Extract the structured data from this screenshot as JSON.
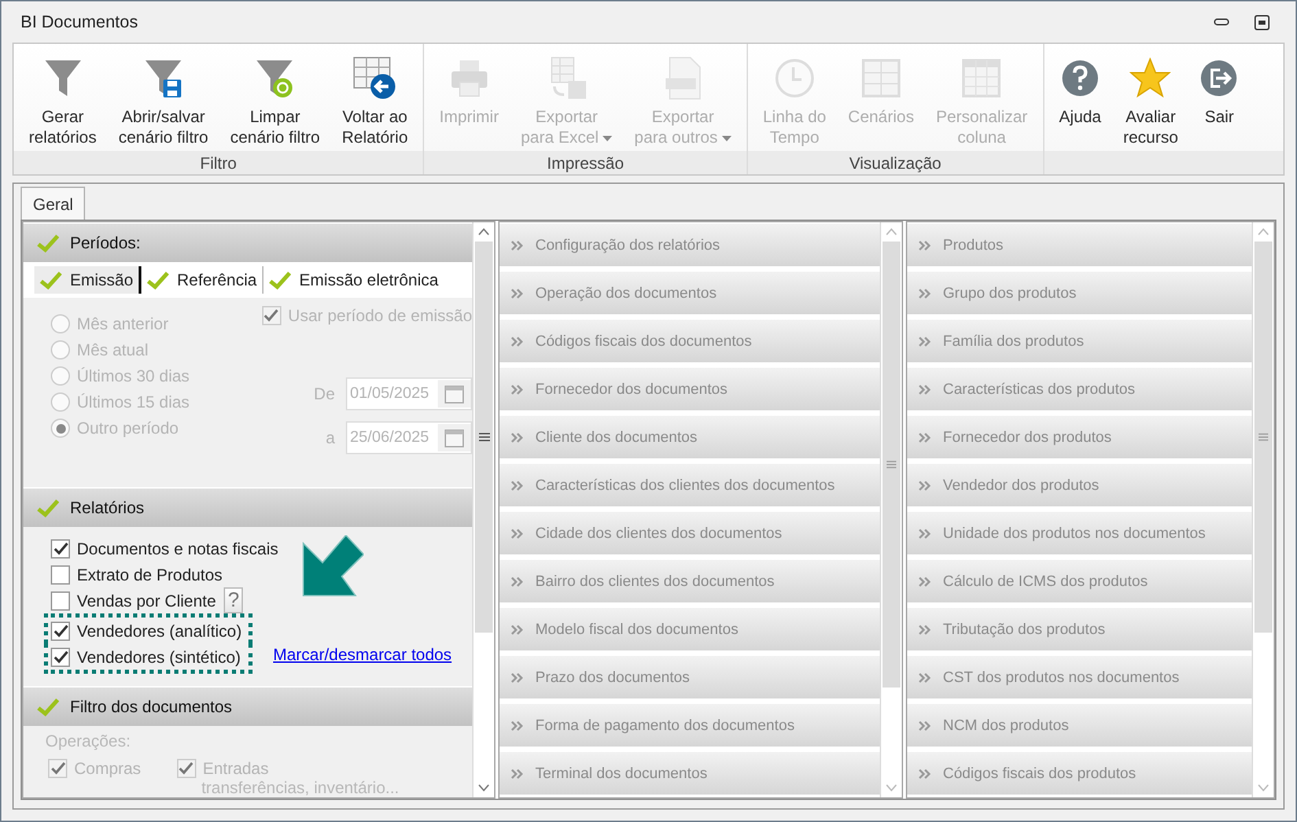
{
  "window": {
    "title": "BI Documentos"
  },
  "ribbon": {
    "groups": [
      {
        "label": "Filtro",
        "buttons": [
          {
            "lines": [
              "Gerar",
              "relatórios"
            ],
            "disabled": false,
            "dropdown": false
          },
          {
            "lines": [
              "Abrir/salvar",
              "cenário filtro"
            ],
            "disabled": false,
            "dropdown": false
          },
          {
            "lines": [
              "Limpar",
              "cenário filtro"
            ],
            "disabled": false,
            "dropdown": false
          },
          {
            "lines": [
              "Voltar ao",
              "Relatório"
            ],
            "disabled": false,
            "dropdown": false
          }
        ]
      },
      {
        "label": "Impressão",
        "buttons": [
          {
            "lines": [
              "Imprimir"
            ],
            "disabled": true,
            "dropdown": false
          },
          {
            "lines": [
              "Exportar",
              "para Excel"
            ],
            "disabled": true,
            "dropdown": true
          },
          {
            "lines": [
              "Exportar",
              "para outros"
            ],
            "disabled": true,
            "dropdown": true
          }
        ]
      },
      {
        "label": "Visualização",
        "buttons": [
          {
            "lines": [
              "Linha do",
              "Tempo"
            ],
            "disabled": true,
            "dropdown": false
          },
          {
            "lines": [
              "Cenários"
            ],
            "disabled": true,
            "dropdown": false
          },
          {
            "lines": [
              "Personalizar",
              "coluna"
            ],
            "disabled": true,
            "dropdown": false
          }
        ]
      },
      {
        "buttons": [
          {
            "lines": [
              "Ajuda"
            ],
            "disabled": false,
            "dropdown": false
          },
          {
            "lines": [
              "Avaliar",
              "recurso"
            ],
            "disabled": false,
            "dropdown": false
          },
          {
            "lines": [
              "Sair"
            ],
            "disabled": false,
            "dropdown": false
          }
        ]
      }
    ]
  },
  "tabs": [
    {
      "label": "Geral",
      "selected": true
    }
  ],
  "periods": {
    "title": "Períodos:",
    "subtabs": [
      {
        "label": "Emissão",
        "selected": true
      },
      {
        "label": "Referência",
        "selected": false
      },
      {
        "label": "Emissão eletrônica",
        "selected": false
      }
    ],
    "options": [
      {
        "label": "Mês anterior",
        "selected": false,
        "disabled": true
      },
      {
        "label": "Mês atual",
        "selected": false,
        "disabled": true
      },
      {
        "label": "Últimos 30 dias",
        "selected": false,
        "disabled": true
      },
      {
        "label": "Últimos 15 dias",
        "selected": false,
        "disabled": true
      },
      {
        "label": "Outro período",
        "selected": true,
        "disabled": true
      }
    ],
    "use_emission": {
      "label": "Usar período de emissão",
      "checked": true,
      "disabled": true
    },
    "dates": [
      {
        "label": "De",
        "value": "01/05/2025",
        "disabled": true
      },
      {
        "label": "a",
        "value": "25/06/2025",
        "disabled": true
      }
    ]
  },
  "reports": {
    "title": "Relatórios",
    "items": [
      {
        "label": "Documentos e notas fiscais",
        "checked": true,
        "highlighted": false
      },
      {
        "label": "Extrato de Produtos",
        "checked": false,
        "highlighted": false
      },
      {
        "label": "Vendas por Cliente",
        "checked": false,
        "highlighted": false,
        "help": "?"
      },
      {
        "label": "Vendedores (analítico)",
        "checked": true,
        "highlighted": true
      },
      {
        "label": "Vendedores (sintético)",
        "checked": true,
        "highlighted": true
      }
    ],
    "link": "Marcar/desmarcar todos"
  },
  "doc_filter": {
    "title": "Filtro dos documentos",
    "group_label": "Operações:",
    "items": [
      {
        "label": "Compras",
        "checked": true,
        "disabled": true
      },
      {
        "label": "Entradas",
        "note": "transferências, inventário...",
        "checked": true,
        "disabled": true
      }
    ]
  },
  "lists": [
    {
      "items": [
        "Configuração dos relatórios",
        "Operação dos documentos",
        "Códigos fiscais dos documentos",
        "Fornecedor dos documentos",
        "Cliente dos documentos",
        "Características dos clientes dos documentos",
        "Cidade dos clientes dos documentos",
        "Bairro dos clientes dos documentos",
        "Modelo fiscal dos documentos",
        "Prazo dos documentos",
        "Forma de pagamento dos documentos",
        "Terminal dos documentos"
      ]
    },
    {
      "items": [
        "Produtos",
        "Grupo dos produtos",
        "Família dos produtos",
        "Características dos produtos",
        "Fornecedor dos produtos",
        "Vendedor dos produtos",
        "Unidade dos produtos nos documentos",
        "Cálculo de ICMS dos produtos",
        "Tributação dos produtos",
        "CST dos produtos nos documentos",
        "NCM dos produtos",
        "Códigos fiscais dos produtos"
      ]
    }
  ]
}
